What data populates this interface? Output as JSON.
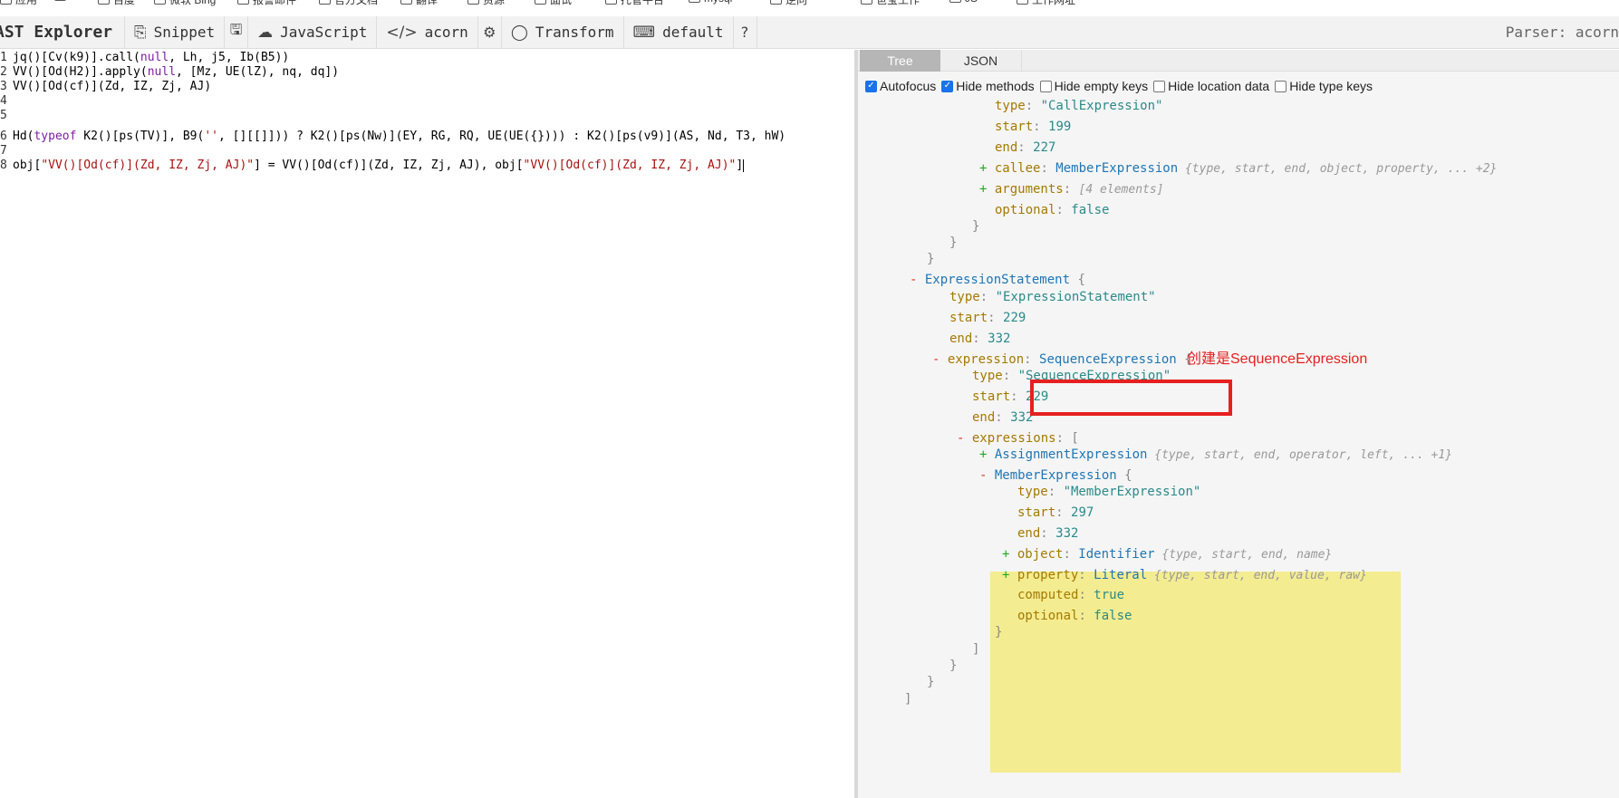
{
  "bookmarks": [
    {
      "label": "应用",
      "icon": "apps-icon"
    },
    {
      "label": "",
      "icon": "grid-icon"
    },
    {
      "label": "百度",
      "icon": "baidu-icon"
    },
    {
      "label": "微软 Bing",
      "icon": "bing-icon"
    },
    {
      "label": "报警邮件",
      "icon": "folder-icon"
    },
    {
      "label": "官方文档",
      "icon": "folder-icon"
    },
    {
      "label": "翻译",
      "icon": "folder-icon"
    },
    {
      "label": "资源",
      "icon": "folder-icon"
    },
    {
      "label": "面试",
      "icon": "folder-icon"
    },
    {
      "label": "托管平台",
      "icon": "folder-icon"
    },
    {
      "label": "mysql",
      "icon": "folder-icon"
    },
    {
      "label": "逆向",
      "icon": "folder-icon"
    },
    {
      "label": "爸宝工作",
      "icon": "folder-icon"
    },
    {
      "label": "JS",
      "icon": "folder-icon"
    },
    {
      "label": "工作网址",
      "icon": "folder-icon"
    }
  ],
  "toolbar": {
    "brand": "AST Explorer",
    "snippet": "Snippet",
    "language": "JavaScript",
    "parser": "acorn",
    "transform": "Transform",
    "keymap": "default",
    "help": "?",
    "parser_label": "Parser: acorn"
  },
  "editor": {
    "lines": [
      {
        "n": "1",
        "parts": [
          {
            "t": "jq()[Cv(k9)].call("
          },
          {
            "t": "null",
            "c": "kw"
          },
          {
            "t": ", Lh, j5, Ib(B5))"
          }
        ]
      },
      {
        "n": "2",
        "parts": [
          {
            "t": "VV()[Od(H2)].apply("
          },
          {
            "t": "null",
            "c": "kw"
          },
          {
            "t": ", [Mz, UE(lZ), nq, dq])"
          }
        ]
      },
      {
        "n": "3",
        "parts": [
          {
            "t": "VV()[Od(cf)](Zd, IZ, Zj, AJ)"
          }
        ]
      },
      {
        "n": "4",
        "parts": []
      },
      {
        "n": "5",
        "parts": []
      },
      {
        "n": "6",
        "parts": [
          {
            "t": "Hd("
          },
          {
            "t": "typeof",
            "c": "kw"
          },
          {
            "t": " K2()[ps(TV)], B9("
          },
          {
            "t": "''",
            "c": "str"
          },
          {
            "t": ", [][[]])) ? K2()[ps(Nw)](EY, RG, RQ, UE(UE({}))) : K2()[ps(v9)](AS, Nd, T3, hW)"
          }
        ]
      },
      {
        "n": "7",
        "parts": []
      },
      {
        "n": "8",
        "parts": [
          {
            "t": "obj["
          },
          {
            "t": "\"VV()[Od(cf)](Zd, IZ, Zj, AJ)\"",
            "c": "str"
          },
          {
            "t": "] = VV()[Od(cf)](Zd, IZ, Zj, AJ), obj["
          },
          {
            "t": "\"VV()[Od(cf)](Zd, IZ, Zj, AJ)\"",
            "c": "str"
          },
          {
            "t": "]"
          }
        ]
      }
    ]
  },
  "output": {
    "tabs": [
      "Tree",
      "JSON"
    ],
    "options": [
      {
        "label": "Autofocus",
        "checked": true
      },
      {
        "label": "Hide methods",
        "checked": true
      },
      {
        "label": "Hide empty keys",
        "checked": false
      },
      {
        "label": "Hide location data",
        "checked": false
      },
      {
        "label": "Hide type keys",
        "checked": false
      }
    ]
  },
  "tree": [
    {
      "l": 151,
      "parts": [
        {
          "t": "type",
          "c": "k"
        },
        {
          "t": ": ",
          "c": "br"
        },
        {
          "t": "\"CallExpression\"",
          "c": "sv"
        }
      ]
    },
    {
      "l": 151,
      "parts": [
        {
          "t": "start",
          "c": "k"
        },
        {
          "t": ": ",
          "c": "br"
        },
        {
          "t": "199",
          "c": "nv"
        }
      ]
    },
    {
      "l": 151,
      "parts": [
        {
          "t": "end",
          "c": "k"
        },
        {
          "t": ": ",
          "c": "br"
        },
        {
          "t": "227",
          "c": "nv"
        }
      ]
    },
    {
      "l": 134,
      "parts": [
        {
          "t": "+ ",
          "c": "tog-p"
        },
        {
          "t": "callee",
          "c": "k"
        },
        {
          "t": ": ",
          "c": "br"
        },
        {
          "t": "MemberExpression",
          "c": "nt"
        },
        {
          "t": " {type, start, end, object, property, ... +2}",
          "c": "meta"
        }
      ]
    },
    {
      "l": 134,
      "parts": [
        {
          "t": "+ ",
          "c": "tog-p"
        },
        {
          "t": "arguments",
          "c": "k"
        },
        {
          "t": ": ",
          "c": "br"
        },
        {
          "t": "[4 elements]",
          "c": "meta"
        }
      ]
    },
    {
      "l": 151,
      "parts": [
        {
          "t": "optional",
          "c": "k"
        },
        {
          "t": ": ",
          "c": "br"
        },
        {
          "t": "false",
          "c": "bv"
        }
      ]
    },
    {
      "l": 126,
      "parts": [
        {
          "t": "}",
          "c": "br"
        }
      ]
    },
    {
      "l": 101,
      "parts": [
        {
          "t": "}",
          "c": "br"
        }
      ]
    },
    {
      "l": 76,
      "parts": [
        {
          "t": "}",
          "c": "br"
        }
      ]
    },
    {
      "l": 57,
      "parts": [
        {
          "t": "- ",
          "c": "tog-m"
        },
        {
          "t": "ExpressionStatement",
          "c": "nt"
        },
        {
          "t": "  {",
          "c": "br"
        }
      ]
    },
    {
      "l": 101,
      "parts": [
        {
          "t": "type",
          "c": "k"
        },
        {
          "t": ": ",
          "c": "br"
        },
        {
          "t": "\"ExpressionStatement\"",
          "c": "sv"
        }
      ]
    },
    {
      "l": 101,
      "parts": [
        {
          "t": "start",
          "c": "k"
        },
        {
          "t": ": ",
          "c": "br"
        },
        {
          "t": "229",
          "c": "nv"
        }
      ]
    },
    {
      "l": 101,
      "parts": [
        {
          "t": "end",
          "c": "k"
        },
        {
          "t": ": ",
          "c": "br"
        },
        {
          "t": "332",
          "c": "nv"
        }
      ]
    },
    {
      "l": 82,
      "parts": [
        {
          "t": "- ",
          "c": "tog-m"
        },
        {
          "t": "expression",
          "c": "k"
        },
        {
          "t": ": ",
          "c": "br"
        },
        {
          "t": "SequenceExpression",
          "c": "nt"
        },
        {
          "t": "  {",
          "c": "br"
        }
      ]
    },
    {
      "l": 126,
      "parts": [
        {
          "t": "type",
          "c": "k"
        },
        {
          "t": ": ",
          "c": "br"
        },
        {
          "t": "\"SequenceExpression\"",
          "c": "sv"
        }
      ]
    },
    {
      "l": 126,
      "parts": [
        {
          "t": "start",
          "c": "k"
        },
        {
          "t": ": ",
          "c": "br"
        },
        {
          "t": "229",
          "c": "nv"
        }
      ]
    },
    {
      "l": 126,
      "parts": [
        {
          "t": "end",
          "c": "k"
        },
        {
          "t": ": ",
          "c": "br"
        },
        {
          "t": "332",
          "c": "nv"
        }
      ]
    },
    {
      "l": 109,
      "parts": [
        {
          "t": "- ",
          "c": "tog-m"
        },
        {
          "t": "expressions",
          "c": "k"
        },
        {
          "t": ":  [",
          "c": "br"
        }
      ]
    },
    {
      "l": 134,
      "parts": [
        {
          "t": "+ ",
          "c": "tog-p"
        },
        {
          "t": "AssignmentExpression",
          "c": "nt"
        },
        {
          "t": " {type, start, end, operator, left, ... +1}",
          "c": "meta"
        }
      ]
    },
    {
      "l": 134,
      "parts": [
        {
          "t": "- ",
          "c": "tog-m"
        },
        {
          "t": "MemberExpression",
          "c": "nt"
        },
        {
          "t": "  {",
          "c": "br"
        }
      ]
    },
    {
      "l": 176,
      "parts": [
        {
          "t": "type",
          "c": "k"
        },
        {
          "t": ": ",
          "c": "br"
        },
        {
          "t": "\"MemberExpression\"",
          "c": "sv"
        }
      ]
    },
    {
      "l": 176,
      "parts": [
        {
          "t": "start",
          "c": "k"
        },
        {
          "t": ": ",
          "c": "br"
        },
        {
          "t": "297",
          "c": "nv"
        }
      ]
    },
    {
      "l": 176,
      "parts": [
        {
          "t": "end",
          "c": "k"
        },
        {
          "t": ": ",
          "c": "br"
        },
        {
          "t": "332",
          "c": "nv"
        }
      ]
    },
    {
      "l": 159,
      "parts": [
        {
          "t": "+ ",
          "c": "tog-p"
        },
        {
          "t": "object",
          "c": "k"
        },
        {
          "t": ": ",
          "c": "br"
        },
        {
          "t": "Identifier",
          "c": "nt"
        },
        {
          "t": " {type, start, end, name}",
          "c": "meta"
        }
      ]
    },
    {
      "l": 159,
      "parts": [
        {
          "t": "+ ",
          "c": "tog-p"
        },
        {
          "t": "property",
          "c": "k"
        },
        {
          "t": ": ",
          "c": "br"
        },
        {
          "t": "Literal",
          "c": "nt"
        },
        {
          "t": " {type, start, end, value, raw}",
          "c": "meta"
        }
      ]
    },
    {
      "l": 176,
      "parts": [
        {
          "t": "computed",
          "c": "k"
        },
        {
          "t": ": ",
          "c": "br"
        },
        {
          "t": "true",
          "c": "bv"
        }
      ]
    },
    {
      "l": 176,
      "parts": [
        {
          "t": "optional",
          "c": "k"
        },
        {
          "t": ": ",
          "c": "br"
        },
        {
          "t": "false",
          "c": "bv"
        }
      ]
    },
    {
      "l": 151,
      "parts": [
        {
          "t": "}",
          "c": "br"
        }
      ]
    },
    {
      "l": 126,
      "parts": [
        {
          "t": "]",
          "c": "br"
        }
      ]
    },
    {
      "l": 101,
      "parts": [
        {
          "t": "}",
          "c": "br"
        }
      ]
    },
    {
      "l": 76,
      "parts": [
        {
          "t": "}",
          "c": "br"
        }
      ]
    },
    {
      "l": 51,
      "parts": [
        {
          "t": "]",
          "c": "br"
        }
      ]
    }
  ],
  "annotation": {
    "text": "创建是SequenceExpression",
    "color": "#e62020"
  },
  "colors": {
    "highlight": "#f4ec90",
    "node_type": "#1f76b5",
    "key": "#a57a00",
    "value": "#2b8a8a"
  }
}
